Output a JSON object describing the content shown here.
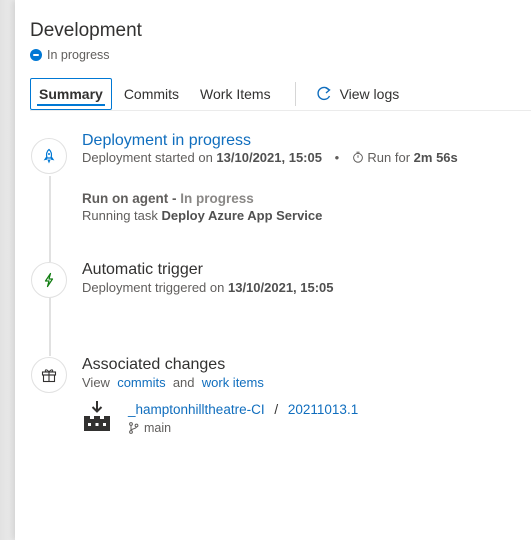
{
  "header": {
    "title": "Development",
    "status": "In progress"
  },
  "tabs": [
    {
      "label": "Summary",
      "active": true
    },
    {
      "label": "Commits",
      "active": false
    },
    {
      "label": "Work Items",
      "active": false
    }
  ],
  "view_logs_label": "View logs",
  "deployment": {
    "title": "Deployment in progress",
    "started_prefix": "Deployment started on",
    "started_at": "13/10/2021, 15:05",
    "run_for_prefix": "Run for",
    "duration": "2m 56s",
    "agent_label": "Run on agent -",
    "agent_status": "In progress",
    "task_prefix": "Running task",
    "task_name": "Deploy Azure App Service"
  },
  "trigger": {
    "title": "Automatic trigger",
    "desc_prefix": "Deployment triggered on",
    "triggered_at": "13/10/2021, 15:05"
  },
  "changes": {
    "title": "Associated changes",
    "view_prefix": "View",
    "commits_link": "commits",
    "and_word": "and",
    "work_items_link": "work items",
    "pipeline_name": "_hamptonhilltheatre-CI",
    "slash": "/",
    "build_number": "20211013.1",
    "branch": "main"
  },
  "colors": {
    "accent": "#0078d4",
    "link": "#106ebe"
  },
  "icons": [
    "in-progress-icon",
    "redo-arrow-icon",
    "rocket-icon",
    "stopwatch-icon",
    "lightning-icon",
    "gift-icon",
    "build-artifact-icon",
    "branch-icon"
  ]
}
